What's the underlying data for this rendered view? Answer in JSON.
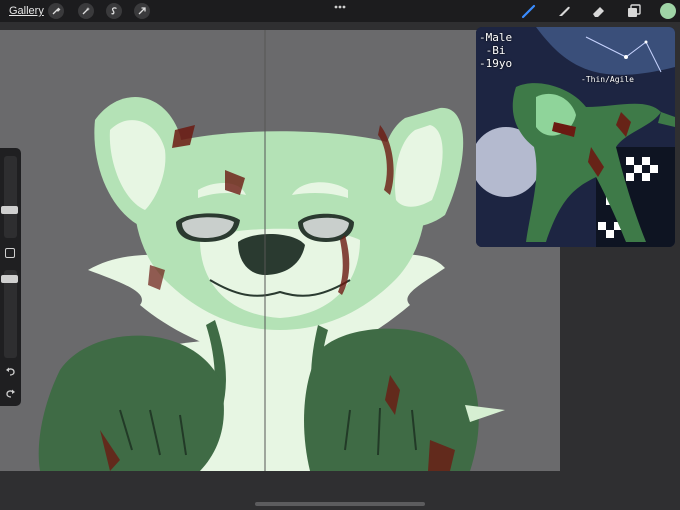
{
  "topbar": {
    "gallery_label": "Gallery",
    "tools_left": [
      "wrench-icon",
      "magic-wand-icon",
      "selection-s-icon",
      "transform-arrow-icon"
    ],
    "tools_right": [
      "brush-icon",
      "smudge-icon",
      "eraser-icon",
      "layers-icon"
    ],
    "active_color": "#9fd4a6"
  },
  "reference": {
    "lines": [
      "-Male",
      " -Bi",
      "-19yo"
    ],
    "build_label": "-Thin/Agile"
  },
  "colors": {
    "canvas_bg": "#6a6a6c",
    "fur_light": "#b4e2b6",
    "fur_pale": "#e7f6e3",
    "fur_dark": "#3f6b45",
    "blood": "#6b1a12"
  }
}
